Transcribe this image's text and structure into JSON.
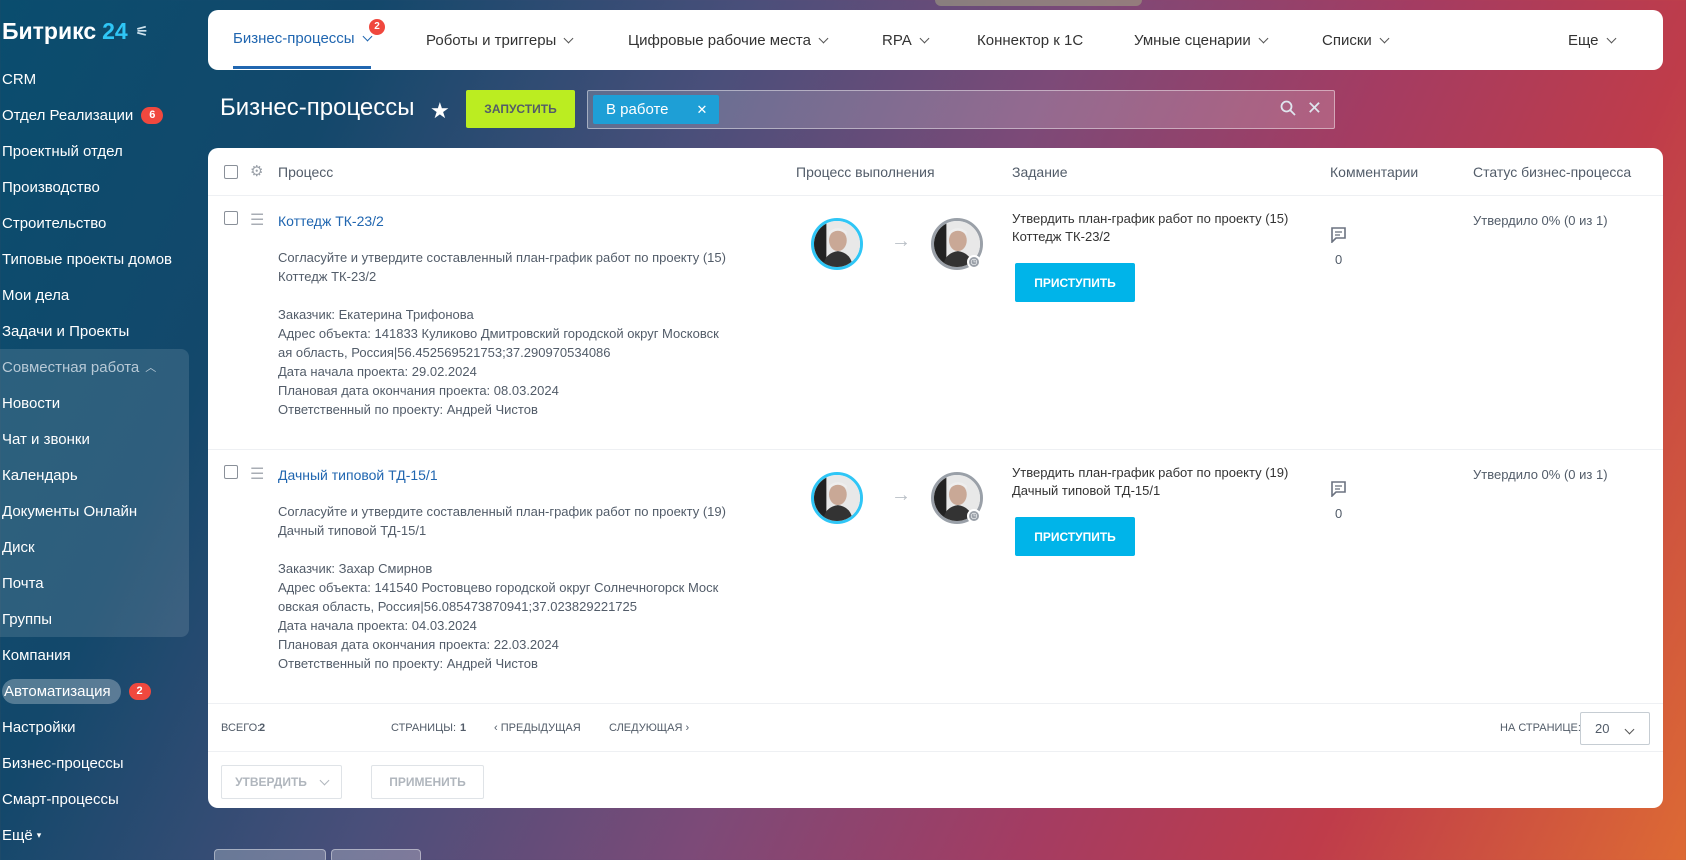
{
  "brand": {
    "name": "Битрикс",
    "num": "24"
  },
  "sidebar": {
    "items": [
      {
        "label": "CRM"
      },
      {
        "label": "Отдел Реализации",
        "badge": "6"
      },
      {
        "label": "Проектный отдел"
      },
      {
        "label": "Производство"
      },
      {
        "label": "Строительство"
      },
      {
        "label": "Типовые проекты домов"
      },
      {
        "label": "Мои дела"
      },
      {
        "label": "Задачи и Проекты"
      },
      {
        "label": "Совместная работа"
      },
      {
        "label": "Новости"
      },
      {
        "label": "Чат и звонки"
      },
      {
        "label": "Календарь"
      },
      {
        "label": "Документы Онлайн"
      },
      {
        "label": "Диск"
      },
      {
        "label": "Почта"
      },
      {
        "label": "Группы"
      },
      {
        "label": "Компания"
      },
      {
        "label": "Автоматизация",
        "badge": "2"
      },
      {
        "label": "Настройки"
      },
      {
        "label": "Бизнес-процессы"
      },
      {
        "label": "Смарт-процессы"
      },
      {
        "label": "Ещё"
      }
    ]
  },
  "topnav": {
    "items": [
      {
        "label": "Бизнес-процессы",
        "badge": "2"
      },
      {
        "label": "Роботы и триггеры"
      },
      {
        "label": "Цифровые рабочие места"
      },
      {
        "label": "RPA"
      },
      {
        "label": "Коннектор к 1С"
      },
      {
        "label": "Умные сценарии"
      },
      {
        "label": "Списки"
      },
      {
        "label": "Еще"
      }
    ]
  },
  "header": {
    "title": "Бизнес-процессы",
    "run_label": "ЗАПУСТИТЬ",
    "filter_chip": "В работе"
  },
  "table": {
    "columns": [
      "Процесс",
      "Процесс выполнения",
      "Задание",
      "Комментарии",
      "Статус бизнес-процесса"
    ],
    "rows": [
      {
        "name": "Коттедж ТК-23/2",
        "desc1": "Согласуйте и утвердите составленный план-график работ по проекту (15)",
        "desc2": "Коттедж ТК-23/2",
        "customer": "Заказчик: Екатерина Трифонова",
        "address1": "Адрес объекта: 141833 Куликово Дмитровский городской округ Московск",
        "address2": "ая область, Россия|56.452569521753;37.290970534086",
        "start": "Дата начала проекта: 29.02.2024",
        "end": "Плановая дата окончания проекта: 08.03.2024",
        "owner": "Ответственный по проекту: Андрей Чистов",
        "task1": "Утвердить план-график работ по проекту (15)",
        "task2": "Коттедж ТК-23/2",
        "task_button": "ПРИСТУПИТЬ",
        "comments": "0",
        "status": "Утвердило 0% (0 из 1)"
      },
      {
        "name": "Дачный типовой ТД-15/1",
        "desc1": "Согласуйте и утвердите составленный план-график работ по проекту (19)",
        "desc2": "Дачный типовой ТД-15/1",
        "customer": "Заказчик: Захар Смирнов",
        "address1": "Адрес объекта: 141540 Ростовцево городской округ Солнечногорск Моск",
        "address2": "овская область, Россия|56.085473870941;37.023829221725",
        "start": "Дата начала проекта: 04.03.2024",
        "end": "Плановая дата окончания проекта: 22.03.2024",
        "owner": "Ответственный по проекту: Андрей Чистов",
        "task1": "Утвердить план-график работ по проекту (19)",
        "task2": "Дачный типовой ТД-15/1",
        "task_button": "ПРИСТУПИТЬ",
        "comments": "0",
        "status": "Утвердило 0% (0 из 1)"
      }
    ]
  },
  "footer": {
    "total_label": "ВСЕГО:",
    "total_value": "2",
    "pages_label": "СТРАНИЦЫ:",
    "page_value": "1",
    "prev_label": "ПРЕДЫДУЩАЯ",
    "next_label": "СЛЕДУЮЩАЯ",
    "per_page_label": "НА СТРАНИЦЕ:",
    "per_page_value": "20",
    "approve_label": "УТВЕРДИТЬ",
    "apply_label": "ПРИМЕНИТЬ"
  },
  "colors": {
    "accent": "#2066b0",
    "run": "#bbed21",
    "start_button": "#00b4e9",
    "badge": "#f0483e"
  }
}
